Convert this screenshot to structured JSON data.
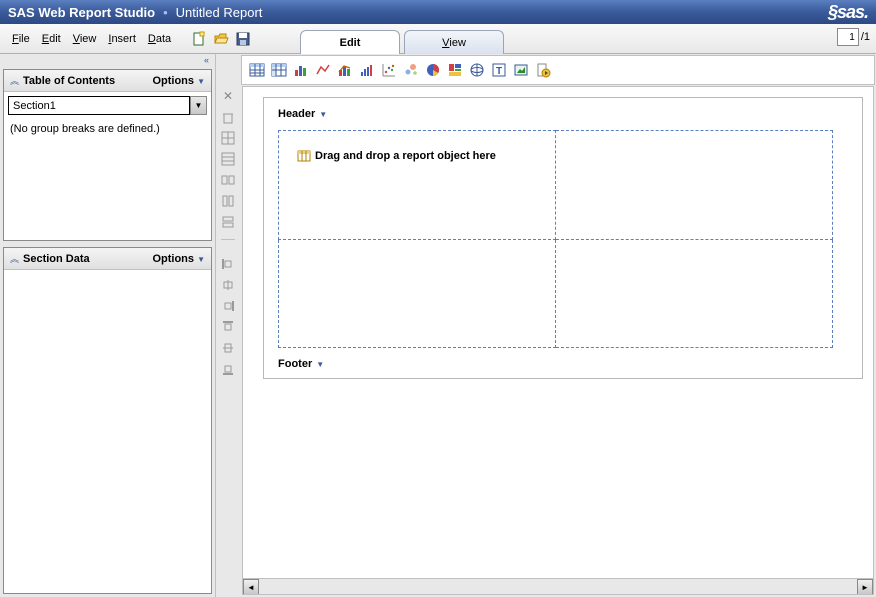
{
  "titlebar": {
    "app_name": "SAS Web Report Studio",
    "report_title": "Untitled Report",
    "logo_text": "Ssas"
  },
  "menu": {
    "file": "File",
    "edit": "Edit",
    "view": "View",
    "insert": "Insert",
    "data": "Data"
  },
  "tabs": {
    "edit": "Edit",
    "view": "View"
  },
  "page": {
    "current": "1",
    "total": "/1"
  },
  "left": {
    "toc_title": "Table of Contents",
    "options_label": "Options",
    "section_selected": "Section1",
    "toc_empty": "(No group breaks are defined.)",
    "section_data_title": "Section Data"
  },
  "canvas": {
    "header_label": "Header",
    "footer_label": "Footer",
    "drop_message": "Drag and drop a report object here"
  },
  "icons": {
    "collapse": "«"
  }
}
